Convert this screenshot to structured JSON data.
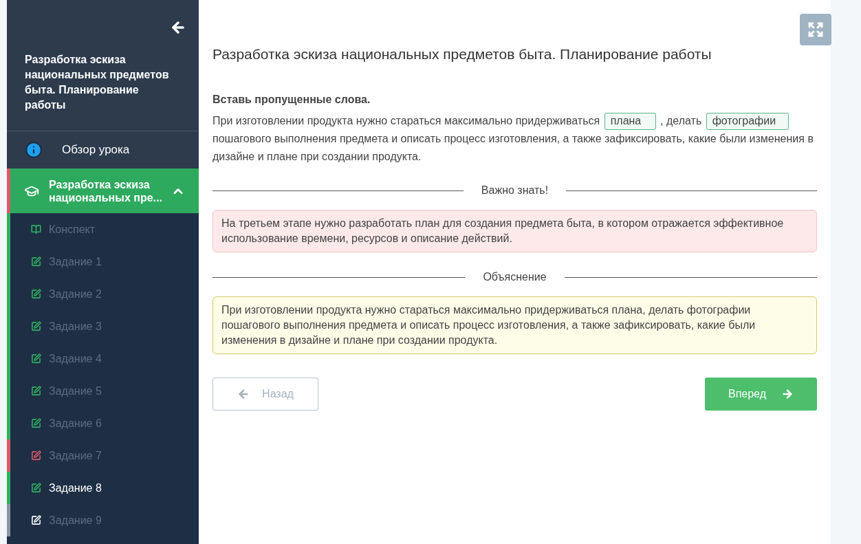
{
  "sidebar": {
    "lesson_title": "Разработка эскиза национальных предметов быта. Планирование работы",
    "overview": {
      "label": "Обзор урока"
    },
    "section": {
      "label": "Разработка эскиза национальных пре...",
      "expanded": true,
      "color": "#d9596a",
      "items": [
        {
          "kind": "notes",
          "label": "Конспект",
          "color": "#2eb15f",
          "selected": false
        },
        {
          "kind": "task",
          "label": "Задание 1",
          "color": "#2eb15f",
          "selected": false
        },
        {
          "kind": "task",
          "label": "Задание 2",
          "color": "#2eb15f",
          "selected": false
        },
        {
          "kind": "task",
          "label": "Задание 3",
          "color": "#2eb15f",
          "selected": false
        },
        {
          "kind": "task",
          "label": "Задание 4",
          "color": "#2eb15f",
          "selected": false
        },
        {
          "kind": "task",
          "label": "Задание 5",
          "color": "#2eb15f",
          "selected": false
        },
        {
          "kind": "task",
          "label": "Задание 6",
          "color": "#2eb15f",
          "selected": false
        },
        {
          "kind": "task",
          "label": "Задание 7",
          "color": "#d9596a",
          "selected": false
        },
        {
          "kind": "task",
          "label": "Задание 8",
          "color": "#2eb15f",
          "selected": true
        },
        {
          "kind": "task",
          "label": "Задание 9",
          "color": "#8a94a3",
          "selected": false
        }
      ]
    }
  },
  "main": {
    "title": "Разработка эскиза национальных предметов быта. Планирование работы",
    "instruction": "Вставь пропущенные слова.",
    "exercise": [
      {
        "kind": "text",
        "text": "При изготовлении продукта нужно стараться максимально придерживаться "
      },
      {
        "kind": "blank",
        "value": "плана"
      },
      {
        "kind": "text",
        "text": " , делать "
      },
      {
        "kind": "blank",
        "value": "фотографии"
      },
      {
        "kind": "text",
        "text": " пошагового выполнения предмета и описать процесс изготовления, а также зафиксировать, какие были изменения в дизайне и плане при создании продукта."
      }
    ],
    "notes": [
      {
        "kind": "important",
        "heading": "Важно знать!",
        "text": "На третьем этапе нужно разработать план для создания предмета быта, в котором отражается эффективное использование времени, ресурсов и описание действий."
      },
      {
        "kind": "explanation",
        "heading": "Объяснение",
        "text": "При изготовлении продукта нужно стараться максимально придерживаться плана, делать фотографии пошагового выполнения предмета и описать процесс изготовления, а также зафиксировать, какие были изменения в дизайне и плане при создании продукта."
      }
    ],
    "back_button": {
      "label": "Назад",
      "disabled": true
    },
    "next_button": {
      "label": "Вперед",
      "disabled": false
    }
  }
}
